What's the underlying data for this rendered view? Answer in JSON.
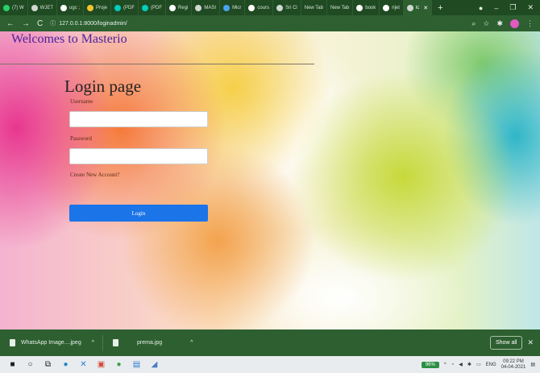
{
  "tabs": [
    {
      "label": "(7) W",
      "icon": "whatsapp-icon",
      "color": "#25d366"
    },
    {
      "label": "WJET",
      "icon": "globe-icon",
      "color": "#cfd8cf"
    },
    {
      "label": "ugc ;",
      "icon": "google-icon",
      "color": "#ffffff"
    },
    {
      "label": "Proje",
      "icon": "pin-icon",
      "color": "#f4c430"
    },
    {
      "label": "(PDF",
      "icon": "researchgate-icon",
      "color": "#00ccbb"
    },
    {
      "label": "(PDF",
      "icon": "researchgate-icon",
      "color": "#00ccbb"
    },
    {
      "label": "Regi",
      "icon": "mail-icon",
      "color": "#ffffff"
    },
    {
      "label": "MASI",
      "icon": "globe-icon",
      "color": "#cfd8cf"
    },
    {
      "label": "Micr",
      "icon": "microsoft-icon",
      "color": "#4aa3f0"
    },
    {
      "label": "cours",
      "icon": "google-icon",
      "color": "#ffffff"
    },
    {
      "label": "Sri Cl",
      "icon": "globe-icon",
      "color": "#cfd8cf"
    },
    {
      "label": "New Tab",
      "icon": "",
      "color": ""
    },
    {
      "label": "New Tab",
      "icon": "",
      "color": ""
    },
    {
      "label": "book",
      "icon": "google-icon",
      "color": "#ffffff"
    },
    {
      "label": "rijet",
      "icon": "google-icon",
      "color": "#ffffff"
    },
    {
      "label": "lc",
      "icon": "globe-icon",
      "color": "#cfd8cf",
      "active": true
    }
  ],
  "browser": {
    "url": "127.0.0.1:8000/loginadmin/",
    "new_tab": "+",
    "profile_initial": ""
  },
  "page": {
    "site_title": "Welcomes to Masterio",
    "heading": "Login page",
    "username_label": "Username",
    "password_label": "Password",
    "create_account": "Create New Account?",
    "login_button": "Login"
  },
  "downloads": {
    "items": [
      "WhatsApp Image....jpeg",
      "prema.jpg"
    ],
    "show_all": "Show all"
  },
  "taskbar": {
    "battery": "96%",
    "language": "ENG",
    "time": "09:22 PM",
    "date": "04-04-2021"
  }
}
